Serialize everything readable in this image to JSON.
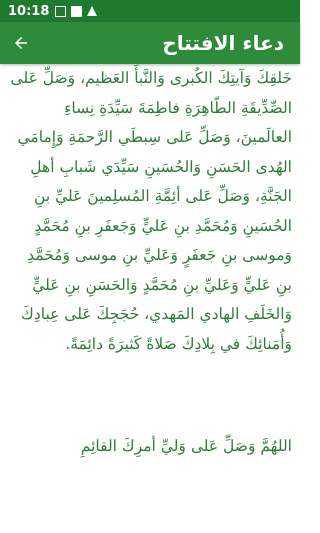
{
  "status_bar": {
    "time": "10:18",
    "icons": [
      "square-icon",
      "play-icon",
      "alert-icon"
    ]
  },
  "app_bar": {
    "title": "دعاء الافتتاح",
    "back_icon": "arrow-left-icon",
    "color": "#2e8b3a"
  },
  "text_color": "#2f7d39",
  "content": {
    "paragraph1": "خَلقِكَ وَآيتِكَ الكُبرى وَالنَّبأَ العَظيم، وَصَلِّ عَلى الصِّدِّيقَةِ الطّاهِرَةِ فاطِمَةَ سَيِّدَةِ نِساءِ العالَمينَ، وَصَلِّ عَلى سِبطَي الرَّحمَةِ وَإِمامَي الهُدى الحَسَنِ وَالحُسَينِ سَيِّدَي شَبابِ أهلِ الجَنَّةِ، وَصَلِّ عَلى أئِمَّةِ المُسلِمينَ عَليِّ بنِ الحُسَينِ وَمُحَمَّدِ بنِ عَليٍّ وَجَعفَرِ بنِ مُحَمَّدٍ وَموسى بنِ جَعفَرٍ وَعَليِّ بنِ موسى وَمُحَمَّدِ بنِ عَليٍّ وَعَليِّ بنِ مُحَمَّدٍ وَالحَسَنِ بنِ عَليٍّ وَالخَلَفِ الهادي المَهدي، حُجَجِكَ عَلى عِبادِكَ وَأُمَنائِكَ في بِلادِكَ صَلاةً كَثيرَةً دائِمَةً.",
    "paragraph2": "اللهُمَّ وَصَلِّ عَلى وَليِّ أمرِكَ القائِمِ"
  }
}
